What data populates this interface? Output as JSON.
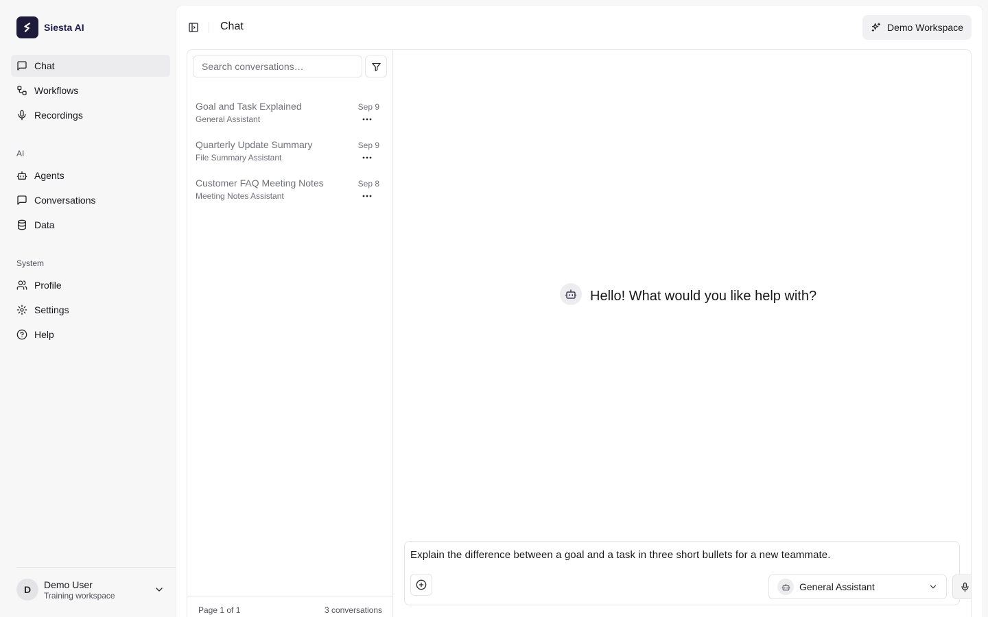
{
  "brand": {
    "name": "Siesta AI"
  },
  "sidebar": {
    "main_items": [
      {
        "label": "Chat",
        "icon": "message-square-icon",
        "active": true
      },
      {
        "label": "Workflows",
        "icon": "workflow-icon"
      },
      {
        "label": "Recordings",
        "icon": "mic-icon"
      }
    ],
    "section_ai": "AI",
    "ai_items": [
      {
        "label": "Agents",
        "icon": "bot-icon"
      },
      {
        "label": "Conversations",
        "icon": "message-square-icon"
      },
      {
        "label": "Data",
        "icon": "database-icon"
      }
    ],
    "section_system": "System",
    "system_items": [
      {
        "label": "Profile",
        "icon": "users-icon"
      },
      {
        "label": "Settings",
        "icon": "gear-icon"
      },
      {
        "label": "Help",
        "icon": "help-circle-icon"
      }
    ]
  },
  "user": {
    "initial": "D",
    "name": "Demo User",
    "workspace": "Training workspace"
  },
  "header": {
    "title": "Chat",
    "workspace_button": "Demo Workspace"
  },
  "conversations": {
    "search_placeholder": "Search conversations…",
    "items": [
      {
        "title": "Goal and Task Explained",
        "agent": "General Assistant",
        "date": "Sep 9"
      },
      {
        "title": "Quarterly Update Summary",
        "agent": "File Summary Assistant",
        "date": "Sep 9"
      },
      {
        "title": "Customer FAQ Meeting Notes",
        "agent": "Meeting Notes Assistant",
        "date": "Sep 8"
      }
    ],
    "page_info": "Page 1 of 1",
    "count_info": "3 conversations"
  },
  "chat": {
    "greeting": "Hello! What would you like help with?",
    "composer_text": "Explain the difference between a goal and a task in three short bullets for a new teammate.",
    "agent_selected": "General Assistant"
  },
  "colors": {
    "brand": "#1e1b3a",
    "active_nav_bg": "#ececee",
    "muted_text": "#71717a"
  }
}
